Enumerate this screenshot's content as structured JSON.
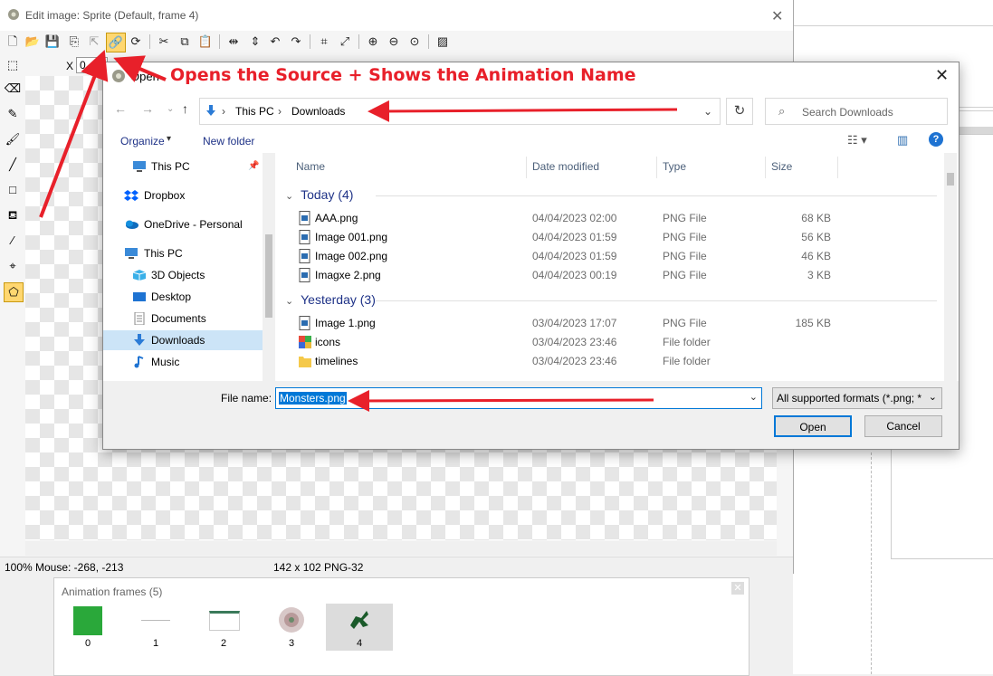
{
  "editor": {
    "title": "Edit image: Sprite (Default, frame 4)",
    "x_label": "X",
    "x_value": "0",
    "status_zoom": "100%",
    "status_mouse": "Mouse: -268, -213",
    "status_size": "142 x 102  PNG-32"
  },
  "background": {
    "partial_label": "t"
  },
  "frames_panel": {
    "title": "Animation frames (5)",
    "frames": [
      {
        "label": "0"
      },
      {
        "label": "1"
      },
      {
        "label": "2"
      },
      {
        "label": "3"
      },
      {
        "label": "4"
      }
    ],
    "selected_index": 4
  },
  "dialog": {
    "title": "Open",
    "annotation": "Opens the Source + Shows the Animation Name",
    "breadcrumb": [
      "This PC",
      "Downloads"
    ],
    "search_placeholder": "Search Downloads",
    "organize_label": "Organize",
    "new_folder_label": "New folder",
    "tree": [
      {
        "label": "This PC",
        "icon": "pc-icon",
        "indent": 1
      },
      {
        "label": "Dropbox",
        "icon": "dropbox-icon",
        "indent": 0
      },
      {
        "label": "OneDrive - Personal",
        "icon": "onedrive-icon",
        "indent": 0
      },
      {
        "label": "This PC",
        "icon": "pc-icon",
        "indent": 0
      },
      {
        "label": "3D Objects",
        "icon": "cube-icon",
        "indent": 1
      },
      {
        "label": "Desktop",
        "icon": "desktop-icon",
        "indent": 1
      },
      {
        "label": "Documents",
        "icon": "document-icon",
        "indent": 1
      },
      {
        "label": "Downloads",
        "icon": "download-icon",
        "indent": 1,
        "selected": true
      },
      {
        "label": "Music",
        "icon": "music-icon",
        "indent": 1
      }
    ],
    "columns": [
      "Name",
      "Date modified",
      "Type",
      "Size"
    ],
    "groups": [
      {
        "label": "Today (4)",
        "files": [
          {
            "name": "AAA.png",
            "date": "04/04/2023 02:00",
            "type": "PNG File",
            "size": "68 KB",
            "icon": "file-icon"
          },
          {
            "name": "Image 001.png",
            "date": "04/04/2023 01:59",
            "type": "PNG File",
            "size": "56 KB",
            "icon": "file-icon"
          },
          {
            "name": "Image 002.png",
            "date": "04/04/2023 01:59",
            "type": "PNG File",
            "size": "46 KB",
            "icon": "file-icon"
          },
          {
            "name": "Imagxe 2.png",
            "date": "04/04/2023 00:19",
            "type": "PNG File",
            "size": "3 KB",
            "icon": "file-icon"
          }
        ]
      },
      {
        "label": "Yesterday (3)",
        "files": [
          {
            "name": "Image 1.png",
            "date": "03/04/2023 17:07",
            "type": "PNG File",
            "size": "185 KB",
            "icon": "file-icon"
          },
          {
            "name": "icons",
            "date": "03/04/2023 23:46",
            "type": "File folder",
            "size": "",
            "icon": "folder-icon"
          },
          {
            "name": "timelines",
            "date": "03/04/2023 23:46",
            "type": "File folder",
            "size": "",
            "icon": "folder-icon"
          }
        ]
      }
    ],
    "filename_label": "File name:",
    "filename_value": "Monsters.png",
    "format_value": "All supported formats (*.png; *.",
    "open_label": "Open",
    "cancel_label": "Cancel"
  },
  "colors": {
    "annotation": "#e8202a",
    "accent": "#0078d7",
    "selection": "#cce4f7"
  }
}
